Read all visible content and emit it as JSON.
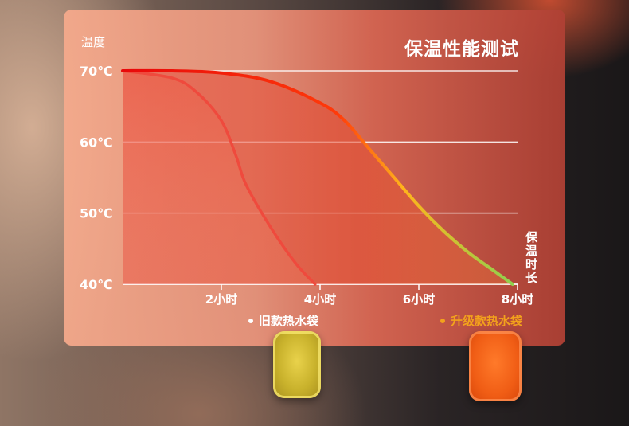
{
  "chart_data": {
    "type": "line",
    "title": "保温性能测试",
    "ylabel": "温度",
    "xlabel": "保温时长",
    "y_ticks": [
      "40℃",
      "50℃",
      "60℃",
      "70℃"
    ],
    "x_ticks": [
      "2小时",
      "4小时",
      "6小时",
      "8小时"
    ],
    "x_tick_values": [
      2,
      4,
      6,
      8
    ],
    "y_tick_values": [
      40,
      50,
      60,
      70
    ],
    "xlim": [
      0,
      8
    ],
    "ylim": [
      40,
      70
    ],
    "grid": true,
    "legend_position": "bottom",
    "series": [
      {
        "name": "旧款热水袋",
        "color": "#ef4a3d",
        "x": [
          0,
          1,
          1.5,
          2,
          2.3,
          2.5,
          3,
          3.5,
          3.9
        ],
        "y": [
          70,
          69,
          67,
          63,
          58,
          54,
          48,
          43,
          40
        ]
      },
      {
        "name": "升级款热水袋",
        "color": "#e8080a",
        "color_end": "#8fd14f",
        "x": [
          0,
          1,
          2,
          3,
          4,
          4.5,
          5,
          5.5,
          6,
          6.5,
          7,
          7.5,
          7.9
        ],
        "y": [
          70,
          70,
          69.7,
          68.5,
          65.5,
          63,
          59,
          55,
          51,
          47.5,
          44.5,
          42,
          40
        ]
      }
    ]
  },
  "legend": {
    "old_label": "旧款热水袋",
    "new_label": "升级款热水袋"
  },
  "products": {
    "old_color": "#d9c03a",
    "new_color": "#f2611a"
  }
}
